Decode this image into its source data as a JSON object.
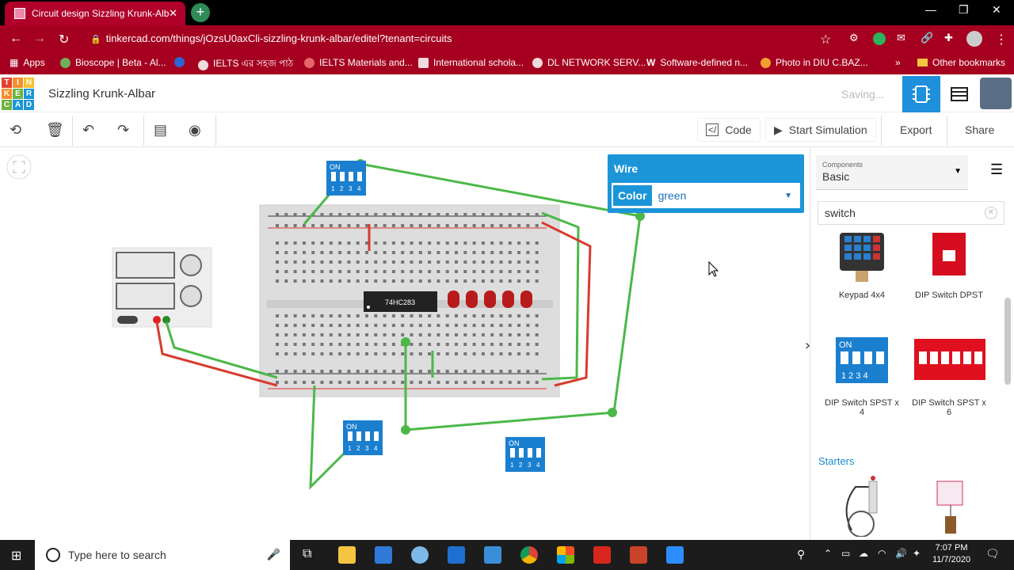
{
  "browser": {
    "tab_title": "Circuit design Sizzling Krunk-Alb",
    "new_tab": "+",
    "url": "tinkercad.com/things/jOzsU0axCli-sizzling-krunk-albar/editel?tenant=circuits",
    "bookmarks": [
      "Apps",
      "Bioscope | Beta - Al...",
      "IELTS এর সহজ পাঠ",
      "IELTS Materials and...",
      "International schola...",
      "DL NETWORK SERV...",
      "Software-defined n...",
      "Photo in DIU C.BAZ...",
      "Other bookmarks"
    ]
  },
  "header": {
    "logo_letters": [
      "TIN",
      "KER",
      "CAD"
    ],
    "design_name": "Sizzling Krunk-Albar",
    "saving": "Saving..."
  },
  "toolbar": {
    "code": "Code",
    "start_simulation": "Start Simulation",
    "export": "Export",
    "share": "Share"
  },
  "wire_panel": {
    "title": "Wire",
    "color_label": "Color",
    "color_value": "green"
  },
  "canvas": {
    "chip_label": "74HC283",
    "dip_label": "ON",
    "dip_numbers": [
      "1",
      "2",
      "3",
      "4"
    ]
  },
  "sidebar": {
    "components_label": "Components",
    "components_value": "Basic",
    "search_value": "switch",
    "items": [
      {
        "label": "Keypad 4x4"
      },
      {
        "label": "DIP Switch DPST"
      },
      {
        "label": "DIP Switch SPST x 4"
      },
      {
        "label": "DIP Switch SPST x 6"
      }
    ],
    "starters_label": "Starters"
  },
  "taskbar": {
    "search_placeholder": "Type here to search",
    "time": "7:07 PM",
    "date": "11/7/2020"
  },
  "colors": {
    "chrome_red": "#a5001f",
    "tinkercad_blue": "#1b95d8",
    "wire_green": "#4cb848",
    "wire_red": "#d83b2f"
  }
}
